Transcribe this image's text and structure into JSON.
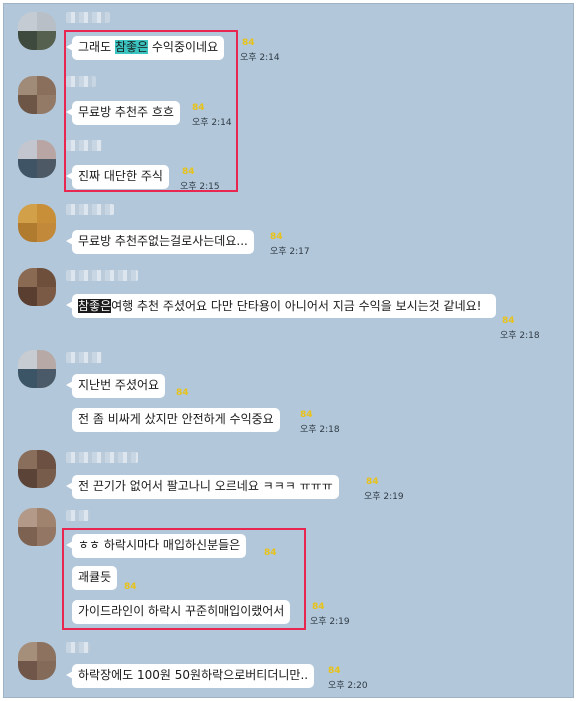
{
  "messages": {
    "m1": {
      "pre": "그래도 ",
      "hl": "참좋은",
      "post": " 수익중이네요",
      "read": "84",
      "time": "오후 2:14"
    },
    "m2": {
      "text": "무료방 추천주 흐흐",
      "read": "84",
      "time": "오후 2:14"
    },
    "m3": {
      "text": "진짜 대단한 주식",
      "read": "84",
      "time": "오후 2:15"
    },
    "m4": {
      "text": "무료방 추천주없는걸로사는데요...",
      "read": "84",
      "time": "오후 2:17"
    },
    "m5": {
      "hl": "참좋은",
      "text": "여행  추천 주셨어요 다만 단타용이 아니어서 지금 수익을 보시는것 같네요!",
      "read": "84",
      "time": "오후 2:18"
    },
    "m6": {
      "text": "지난번 주셨어요",
      "read": "84"
    },
    "m7": {
      "text": "전 좀 비싸게 샀지만 안전하게 수익중요",
      "read": "84",
      "time": "오후 2:18"
    },
    "m8": {
      "text": "전 끈기가 없어서 팔고나니 오르네요 ㅋㅋㅋ ㅠㅠㅠ",
      "read": "84",
      "time": "오후 2:19"
    },
    "m9": {
      "text": "ㅎㅎ 하락시마다 매입하신분들은",
      "read": "84"
    },
    "m10": {
      "text": "괘큘듯",
      "read": "84"
    },
    "m11": {
      "text": "가이드라인이 하락시 꾸준히매입이랬어서",
      "read": "84",
      "time": "오후 2:19"
    },
    "m12": {
      "text": "하락장에도 100원 50원하락으로버티더니만..",
      "read": "84",
      "time": "오후 2:20"
    }
  },
  "colors": {
    "background": "#b2c7d9",
    "bubble": "#ffffff",
    "highlight_box": "#e8264f",
    "read_count": "#e8c218",
    "keyword_teal": "#3bc3c0",
    "keyword_dark": "#1b1b1b"
  }
}
